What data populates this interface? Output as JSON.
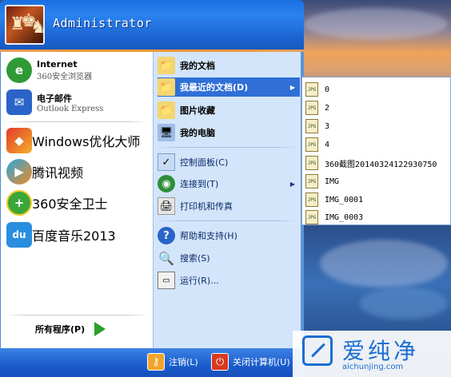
{
  "header": {
    "username": "Administrator"
  },
  "pinned": [
    {
      "title": "Internet",
      "subtitle": "360安全浏览器",
      "icon": "browser-360-icon",
      "color": "#2f9a35"
    },
    {
      "title": "电子邮件",
      "subtitle": "Outlook Express",
      "icon": "outlook-express-icon",
      "color": "#2a64c8"
    }
  ],
  "recent_programs": [
    {
      "label": "Windows优化大师",
      "icon": "windows-optimizer-icon",
      "color": "#e23a2a"
    },
    {
      "label": "腾讯视频",
      "icon": "tencent-video-icon",
      "color": "#29a6e0"
    },
    {
      "label": "360安全卫士",
      "icon": "360-safeguard-icon",
      "color": "#3aa838"
    },
    {
      "label": "百度音乐2013",
      "icon": "baidu-music-icon",
      "color": "#2a8ee0"
    }
  ],
  "all_programs": {
    "label": "所有程序(P)"
  },
  "right": {
    "items": [
      {
        "label": "我的文档",
        "icon": "my-documents-icon"
      },
      {
        "label": "我最近的文档(D)",
        "icon": "recent-documents-icon"
      },
      {
        "label": "图片收藏",
        "icon": "my-pictures-icon"
      },
      {
        "label": "我的电脑",
        "icon": "my-computer-icon"
      },
      {
        "label": "控制面板(C)",
        "icon": "control-panel-icon"
      },
      {
        "label": "连接到(T)",
        "icon": "connect-to-icon"
      },
      {
        "label": "打印机和传真",
        "icon": "printers-faxes-icon"
      },
      {
        "label": "帮助和支持(H)",
        "icon": "help-support-icon"
      },
      {
        "label": "搜索(S)",
        "icon": "search-icon"
      },
      {
        "label": "运行(R)...",
        "icon": "run-icon"
      }
    ]
  },
  "recent_docs": [
    "0",
    "2",
    "3",
    "4",
    "360截图20140324122930750",
    "IMG",
    "IMG_0001",
    "IMG_0003"
  ],
  "recent_doc_icon_text": "JPG",
  "bottom": {
    "logoff": "注销(L)",
    "shutdown": "关闭计算机(U)"
  },
  "watermark": {
    "brand": "爱纯净",
    "url": "aichunjing.com"
  },
  "colors": {
    "menu_blue": "#1c62cf",
    "right_pane": "#d3e5fa",
    "highlight": "#2f6fd6"
  }
}
